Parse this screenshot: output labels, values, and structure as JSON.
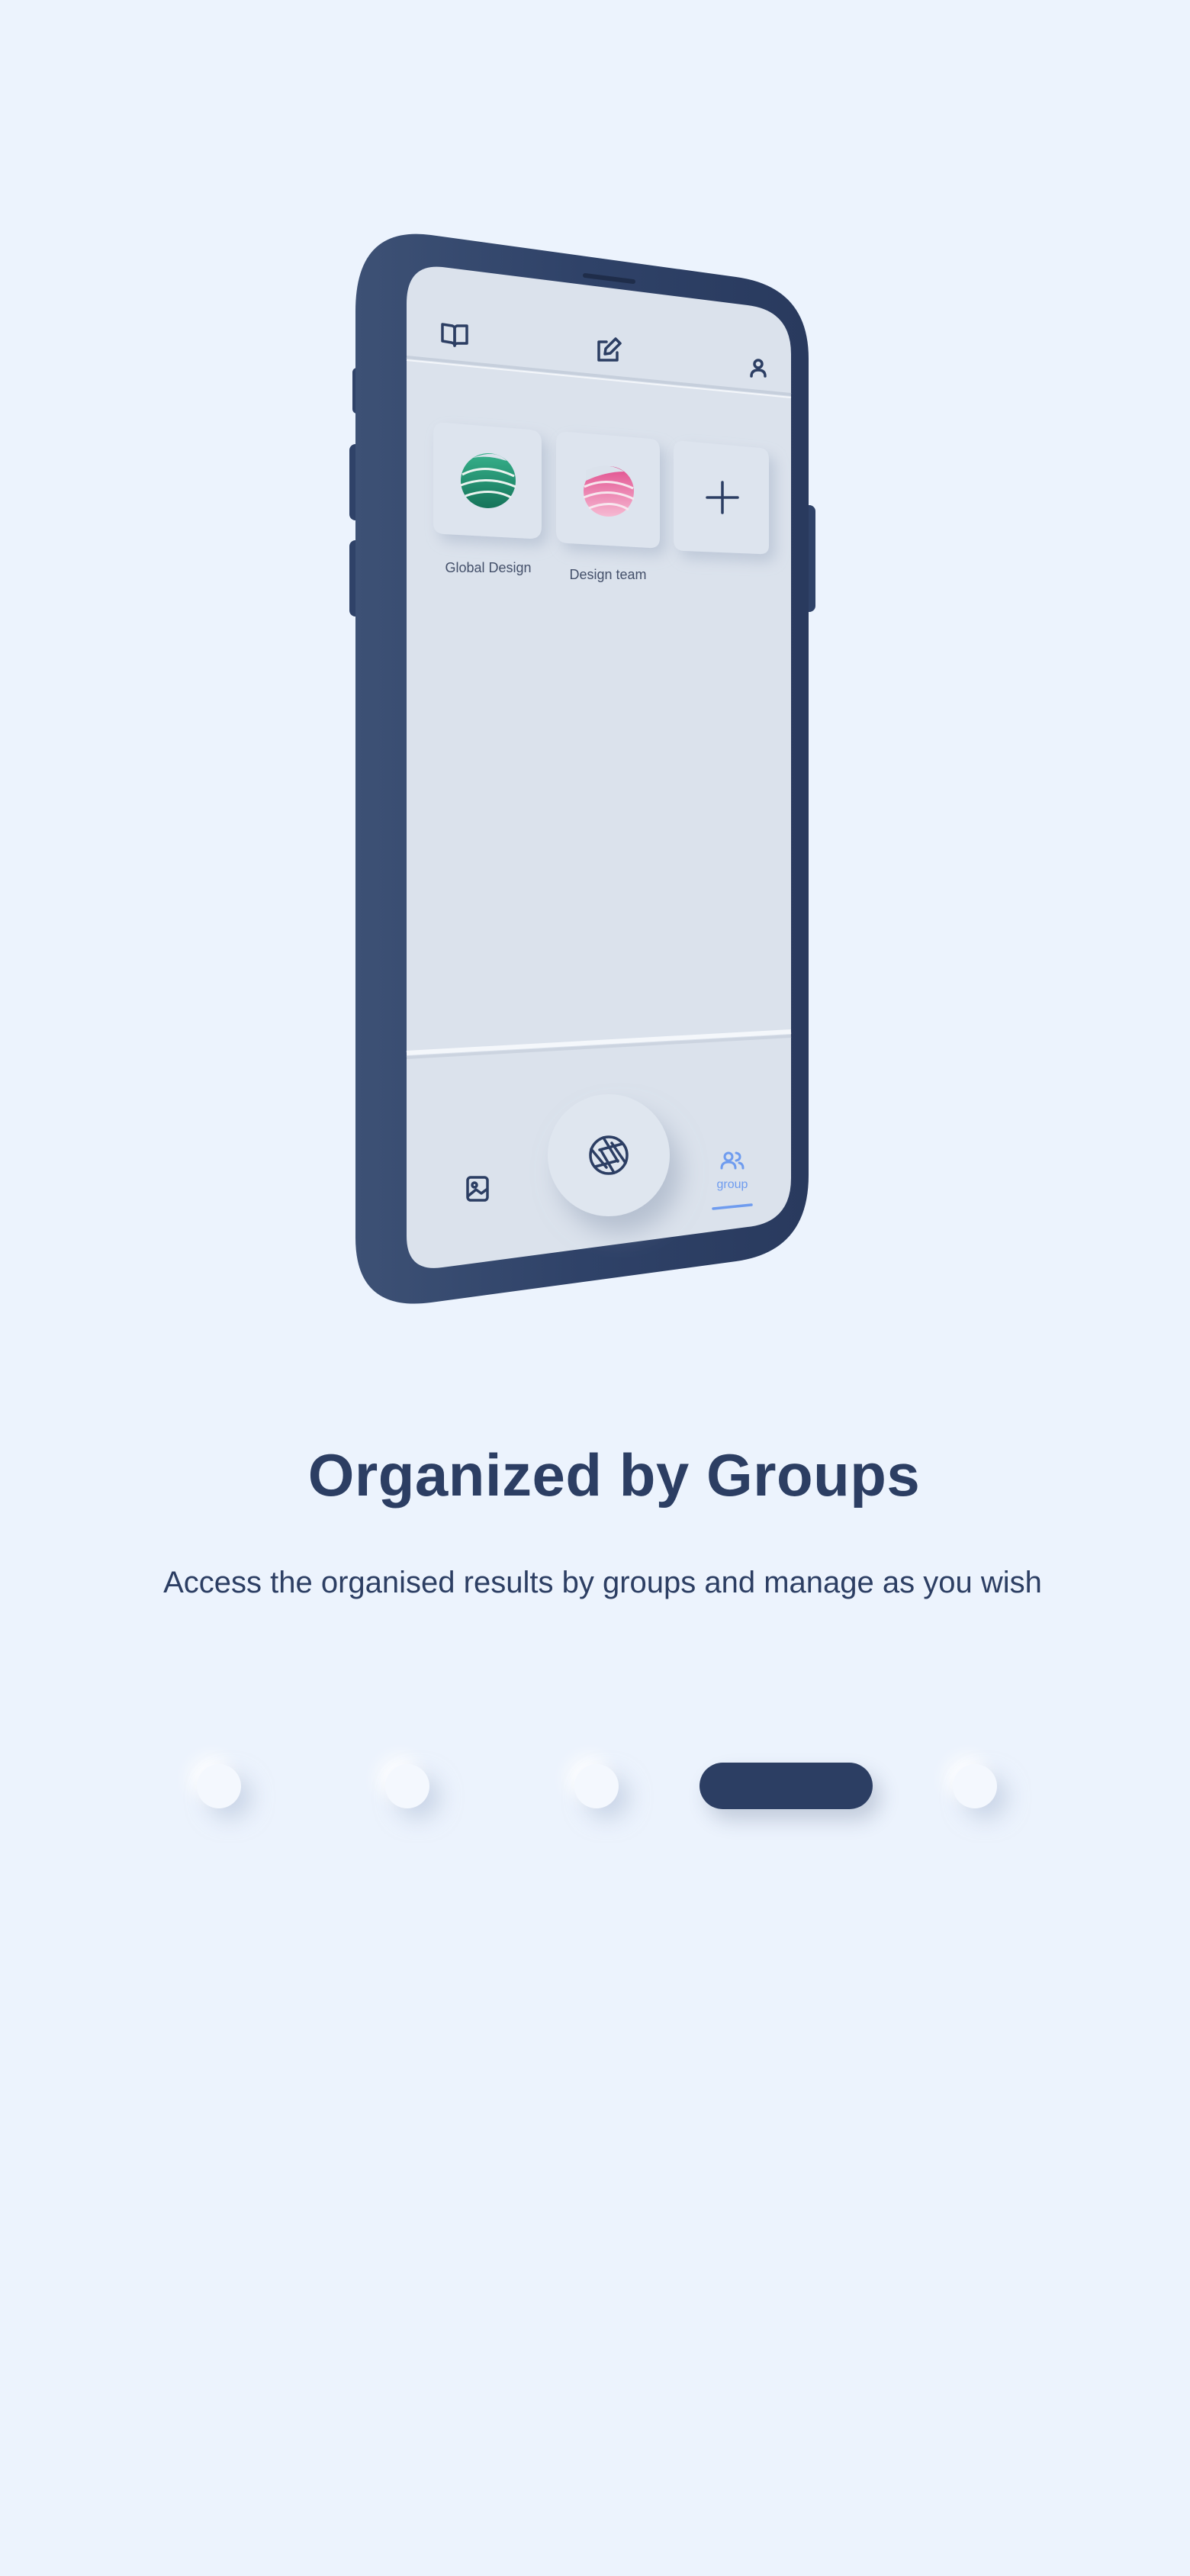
{
  "phone": {
    "groups": [
      {
        "label": "Global Design",
        "icon": "green-globe-icon",
        "color": "#1f8a6a"
      },
      {
        "label": "Design team",
        "icon": "pink-globe-icon",
        "color": "#e96ba0"
      }
    ],
    "add_group_icon": "plus-icon",
    "top_bar_icons": [
      "book-icon",
      "edit-icon",
      "user-icon"
    ],
    "bottom_nav": {
      "gallery_icon": "image-icon",
      "capture_icon": "aperture-icon",
      "group_label": "group",
      "group_icon": "users-icon",
      "active_color": "#6f9cef"
    }
  },
  "onboarding": {
    "title": "Organized by Groups",
    "subtitle": "Access the organised results by groups and manage as you wish"
  },
  "pager": {
    "page_count": 5,
    "active_index": 4
  },
  "colors": {
    "background": "#ecf3fd",
    "primary": "#2c3e63",
    "screen": "#dbe2ec"
  }
}
